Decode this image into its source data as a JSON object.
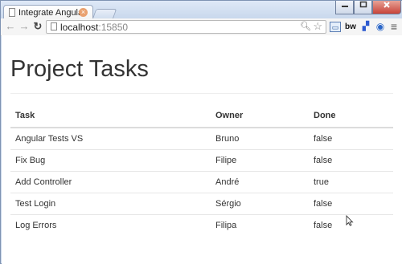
{
  "browser": {
    "tab_title": "Integrate Angular Tes",
    "tab_close": "×",
    "url_host": "localhost",
    "url_port": ":15850"
  },
  "page": {
    "title": "Project Tasks",
    "columns": [
      "Task",
      "Owner",
      "Done"
    ],
    "rows": [
      [
        "Angular Tests VS",
        "Bruno",
        "false"
      ],
      [
        "Fix Bug",
        "Filipe",
        "false"
      ],
      [
        "Add Controller",
        "André",
        "true"
      ],
      [
        "Test Login",
        "Sérgio",
        "false"
      ],
      [
        "Log Errors",
        "Filipa",
        "false"
      ]
    ]
  },
  "icons": {
    "back": "back-arrow-icon",
    "forward": "forward-arrow-icon",
    "reload": "reload-icon",
    "zoom": "magnifier-icon",
    "bookmark": "star-icon",
    "menu": "hamburger-menu-icon"
  },
  "colors": {
    "frame": "#c8d6ea",
    "header_rule": "#dcdcdc",
    "text": "#333333"
  }
}
